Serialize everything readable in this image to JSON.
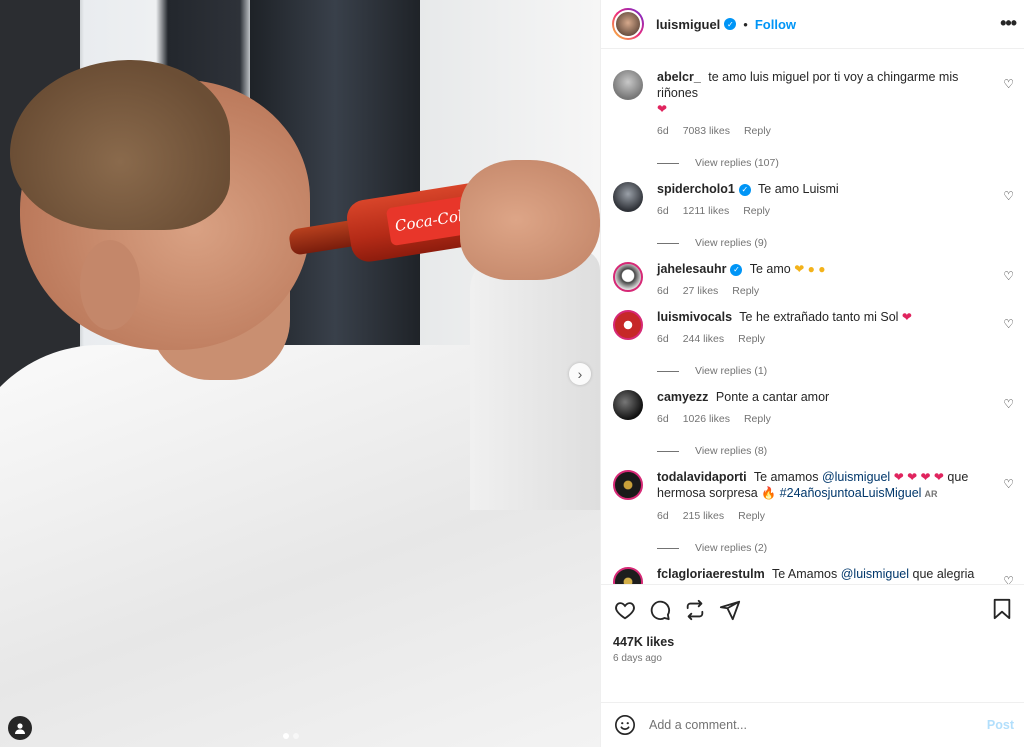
{
  "header": {
    "username": "luismiguel",
    "separator": "•",
    "follow_label": "Follow",
    "more_glyph": "•••"
  },
  "photo": {
    "bottle_label": "Coca-Cola",
    "next_glyph": "›"
  },
  "comments": [
    {
      "user": "abelcr_",
      "text": "te amo luis miguel por ti voy a chingarme mis riñones",
      "emoji": "❤",
      "time": "6d",
      "likes": "7083 likes",
      "reply": "Reply",
      "view_replies": "View replies (107)"
    },
    {
      "user": "spidercholo1",
      "verified": true,
      "text": "Te amo Luismi",
      "time": "6d",
      "likes": "1211 likes",
      "reply": "Reply",
      "view_replies": "View replies (9)"
    },
    {
      "user": "jahelesauhr",
      "verified": true,
      "text": "Te amo",
      "emoji": "❤ ● ●",
      "time": "6d",
      "likes": "27 likes",
      "reply": "Reply"
    },
    {
      "user": "luismivocals",
      "text": "Te he extrañado tanto mi Sol",
      "emoji": "❤",
      "time": "6d",
      "likes": "244 likes",
      "reply": "Reply",
      "view_replies": "View replies (1)"
    },
    {
      "user": "camyezz",
      "text": "Ponte a cantar amor",
      "time": "6d",
      "likes": "1026 likes",
      "reply": "Reply",
      "view_replies": "View replies (8)"
    },
    {
      "user": "todalavidaporti",
      "text_a": "Te amamos",
      "mention": "@luismiguel",
      "emoji": "❤ ❤ ❤ ❤",
      "text_b": "que hermosa sorpresa",
      "emoji_b": "🔥",
      "hashtag": "#24añosjuntoaLuisMiguel",
      "badge": "AR",
      "time": "6d",
      "likes": "215 likes",
      "reply": "Reply",
      "view_replies": "View replies (2)"
    },
    {
      "user": "fclagloriaerestulm",
      "text_a": "Te Amamos",
      "mention": "@luismiguel",
      "text_b": "que alegria y gran sorpresa, asi arrancamos este ultimo viernes del mes de julio,"
    }
  ],
  "actions": {
    "likes": "447K likes",
    "ago": "6 days ago"
  },
  "add_comment": {
    "placeholder": "Add a comment...",
    "post_label": "Post"
  },
  "colors": {
    "accent": "#0095f6",
    "post_disabled": "#b2dffc",
    "muted": "#737373",
    "heart": "#e0245e"
  }
}
